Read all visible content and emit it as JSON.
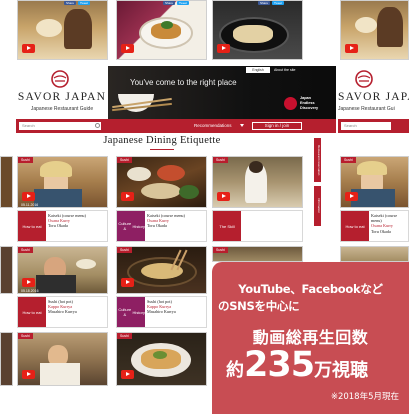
{
  "brand": {
    "name": "SAVOR JAPAN",
    "tagline": "Japanese Restaurant Guide",
    "tagline_right": "Japanese Restaurant Gui"
  },
  "hero": {
    "text": "You've come to the right place",
    "lang": "English",
    "about": "About the site",
    "badge": [
      "Japan",
      "Endless",
      "Discovery"
    ]
  },
  "nav": {
    "search_placeholder": "Search",
    "search_placeholder_right": "Search",
    "recommendations": "Recommendations",
    "sign_in": "Sign in / join"
  },
  "page": {
    "title": "Japanese Dining Etiquette"
  },
  "side_tabs": [
    "Restaurant reservation",
    "Information"
  ],
  "share": {
    "fb": "Share",
    "tw": "Tweet"
  },
  "cards": {
    "tag": "Sushi",
    "date": "05.11.2016",
    "date_b": "05.18.2016",
    "kaiseki": [
      "Kaiseki (course menu)",
      "Oxana Kurry",
      "Toru Okada"
    ],
    "sushi": [
      "Sushi (hot pot)",
      "Kappo Kurrya",
      "Masahiro Kurrya"
    ],
    "how_to_eat": "How to eat",
    "culture": [
      "Culture &",
      "History"
    ],
    "the_skill": "The Skill"
  },
  "overlay": {
    "line1": "YouTube、Facebookなど",
    "line2": "のSNSを中心に",
    "line3": "動画総再生回数",
    "prefix": "約",
    "number": "235",
    "suffix": "万視聴",
    "note": "※2018年5月現在"
  },
  "colors": {
    "brand_red": "#b51f2e",
    "overlay": "#c44046",
    "facebook": "#3b5998",
    "twitter": "#1da1f2"
  }
}
